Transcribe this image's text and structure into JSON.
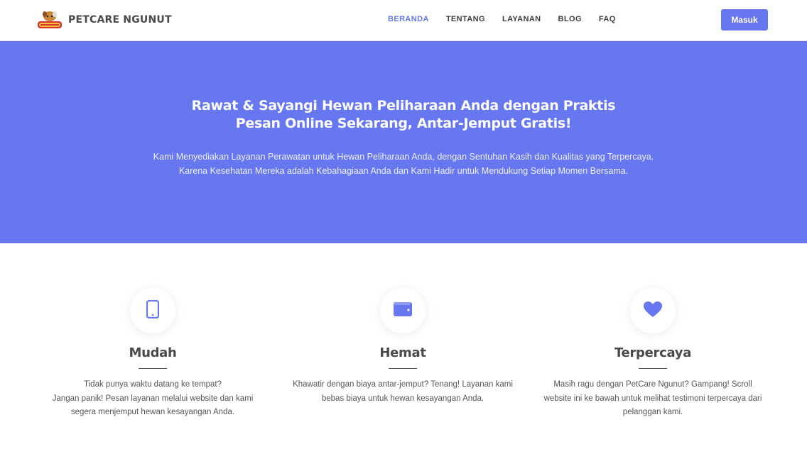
{
  "navbar": {
    "brand": "PETCARE NGUNUT",
    "logo_icon": "petshop-logo",
    "items": [
      {
        "label": "BERANDA",
        "active": true
      },
      {
        "label": "TENTANG",
        "active": false
      },
      {
        "label": "LAYANAN",
        "active": false
      },
      {
        "label": "BLOG",
        "active": false
      },
      {
        "label": "FAQ",
        "active": false
      }
    ],
    "login_label": "Masuk"
  },
  "hero": {
    "title_line1": "Rawat & Sayangi Hewan Peliharaan Anda dengan Praktis",
    "title_line2": "Pesan Online Sekarang, Antar-Jemput Gratis!",
    "sub_line1": "Kami Menyediakan Layanan Perawatan untuk Hewan Peliharaan Anda, dengan Sentuhan Kasih dan Kualitas yang Terpercaya.",
    "sub_line2": "Karena Kesehatan Mereka adalah Kebahagiaan Anda dan Kami Hadir untuk Mendukung Setiap Momen Bersama."
  },
  "features": [
    {
      "icon": "mobile-phone-icon",
      "title": "Mudah",
      "lines": [
        "Tidak punya waktu datang ke tempat?",
        "Jangan panik! Pesan layanan melalui website dan kami",
        "segera menjemput hewan kesayangan Anda."
      ]
    },
    {
      "icon": "wallet-icon",
      "title": "Hemat",
      "lines": [
        "Khawatir dengan biaya antar-jemput? Tenang! Layanan kami",
        "bebas biaya untuk hewan kesayangan Anda."
      ]
    },
    {
      "icon": "heart-icon",
      "title": "Terpercaya",
      "lines": [
        "Masih ragu dengan PetCare Ngunut? Gampang! Scroll",
        "website ini ke bawah untuk melihat testimoni terpercaya dari",
        "pelanggan kami."
      ]
    }
  ],
  "colors": {
    "accent": "#6777ef",
    "text_dark": "#4a4a4a"
  }
}
